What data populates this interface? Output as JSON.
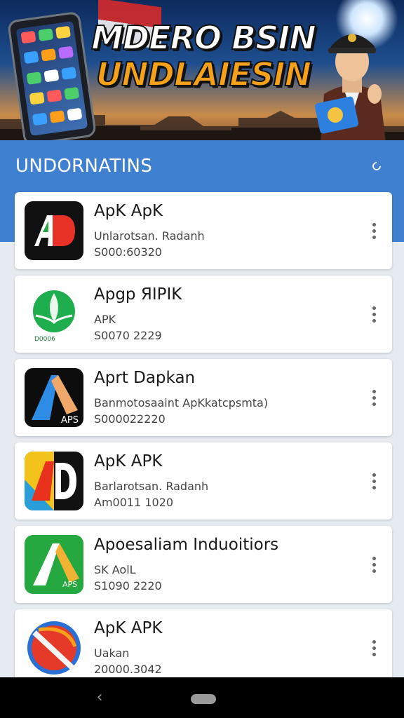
{
  "banner": {
    "title_line1": "MDERO BSIN",
    "title_line2": "UNDLAIESIN"
  },
  "appbar": {
    "title": "UNDORNATINS",
    "action_icon": "refresh-icon"
  },
  "apps": [
    {
      "title": "ApK ApK",
      "subtitle": "Unlarotsan. Radanh",
      "meta": "S000:60320",
      "icon": "ad-logo"
    },
    {
      "title": "Apgp ЯIPIK",
      "subtitle": "APK",
      "meta": "S0070 2229",
      "icon": "green-leaf-logo",
      "icon_caption": "D0006"
    },
    {
      "title": "Aprt Dapkan",
      "subtitle": "Banmotosaaint ApKkatcpsmta)",
      "meta": "S000022220",
      "icon": "a-aps-logo",
      "icon_caption": "APS"
    },
    {
      "title": "ApK APK",
      "subtitle": "Barlarotsan. Radanh",
      "meta": "Am0011 1020",
      "icon": "ad-color-logo"
    },
    {
      "title": "Apoesaliam Induoitiors",
      "subtitle": "SK AolL",
      "meta": "S1090 2220",
      "icon": "green-a-logo",
      "icon_caption": "APS"
    },
    {
      "title": "ApK APK",
      "subtitle": "Uakan",
      "meta": "20000.3042",
      "icon": "red-blue-circle-logo"
    }
  ],
  "colors": {
    "appbar": "#3f80d1",
    "background": "#e6ebf1",
    "card": "#ffffff",
    "title_accent": "#f5a21a"
  },
  "navbar": {
    "back_icon": "back-chevron-icon",
    "home_icon": "home-pill-icon"
  }
}
